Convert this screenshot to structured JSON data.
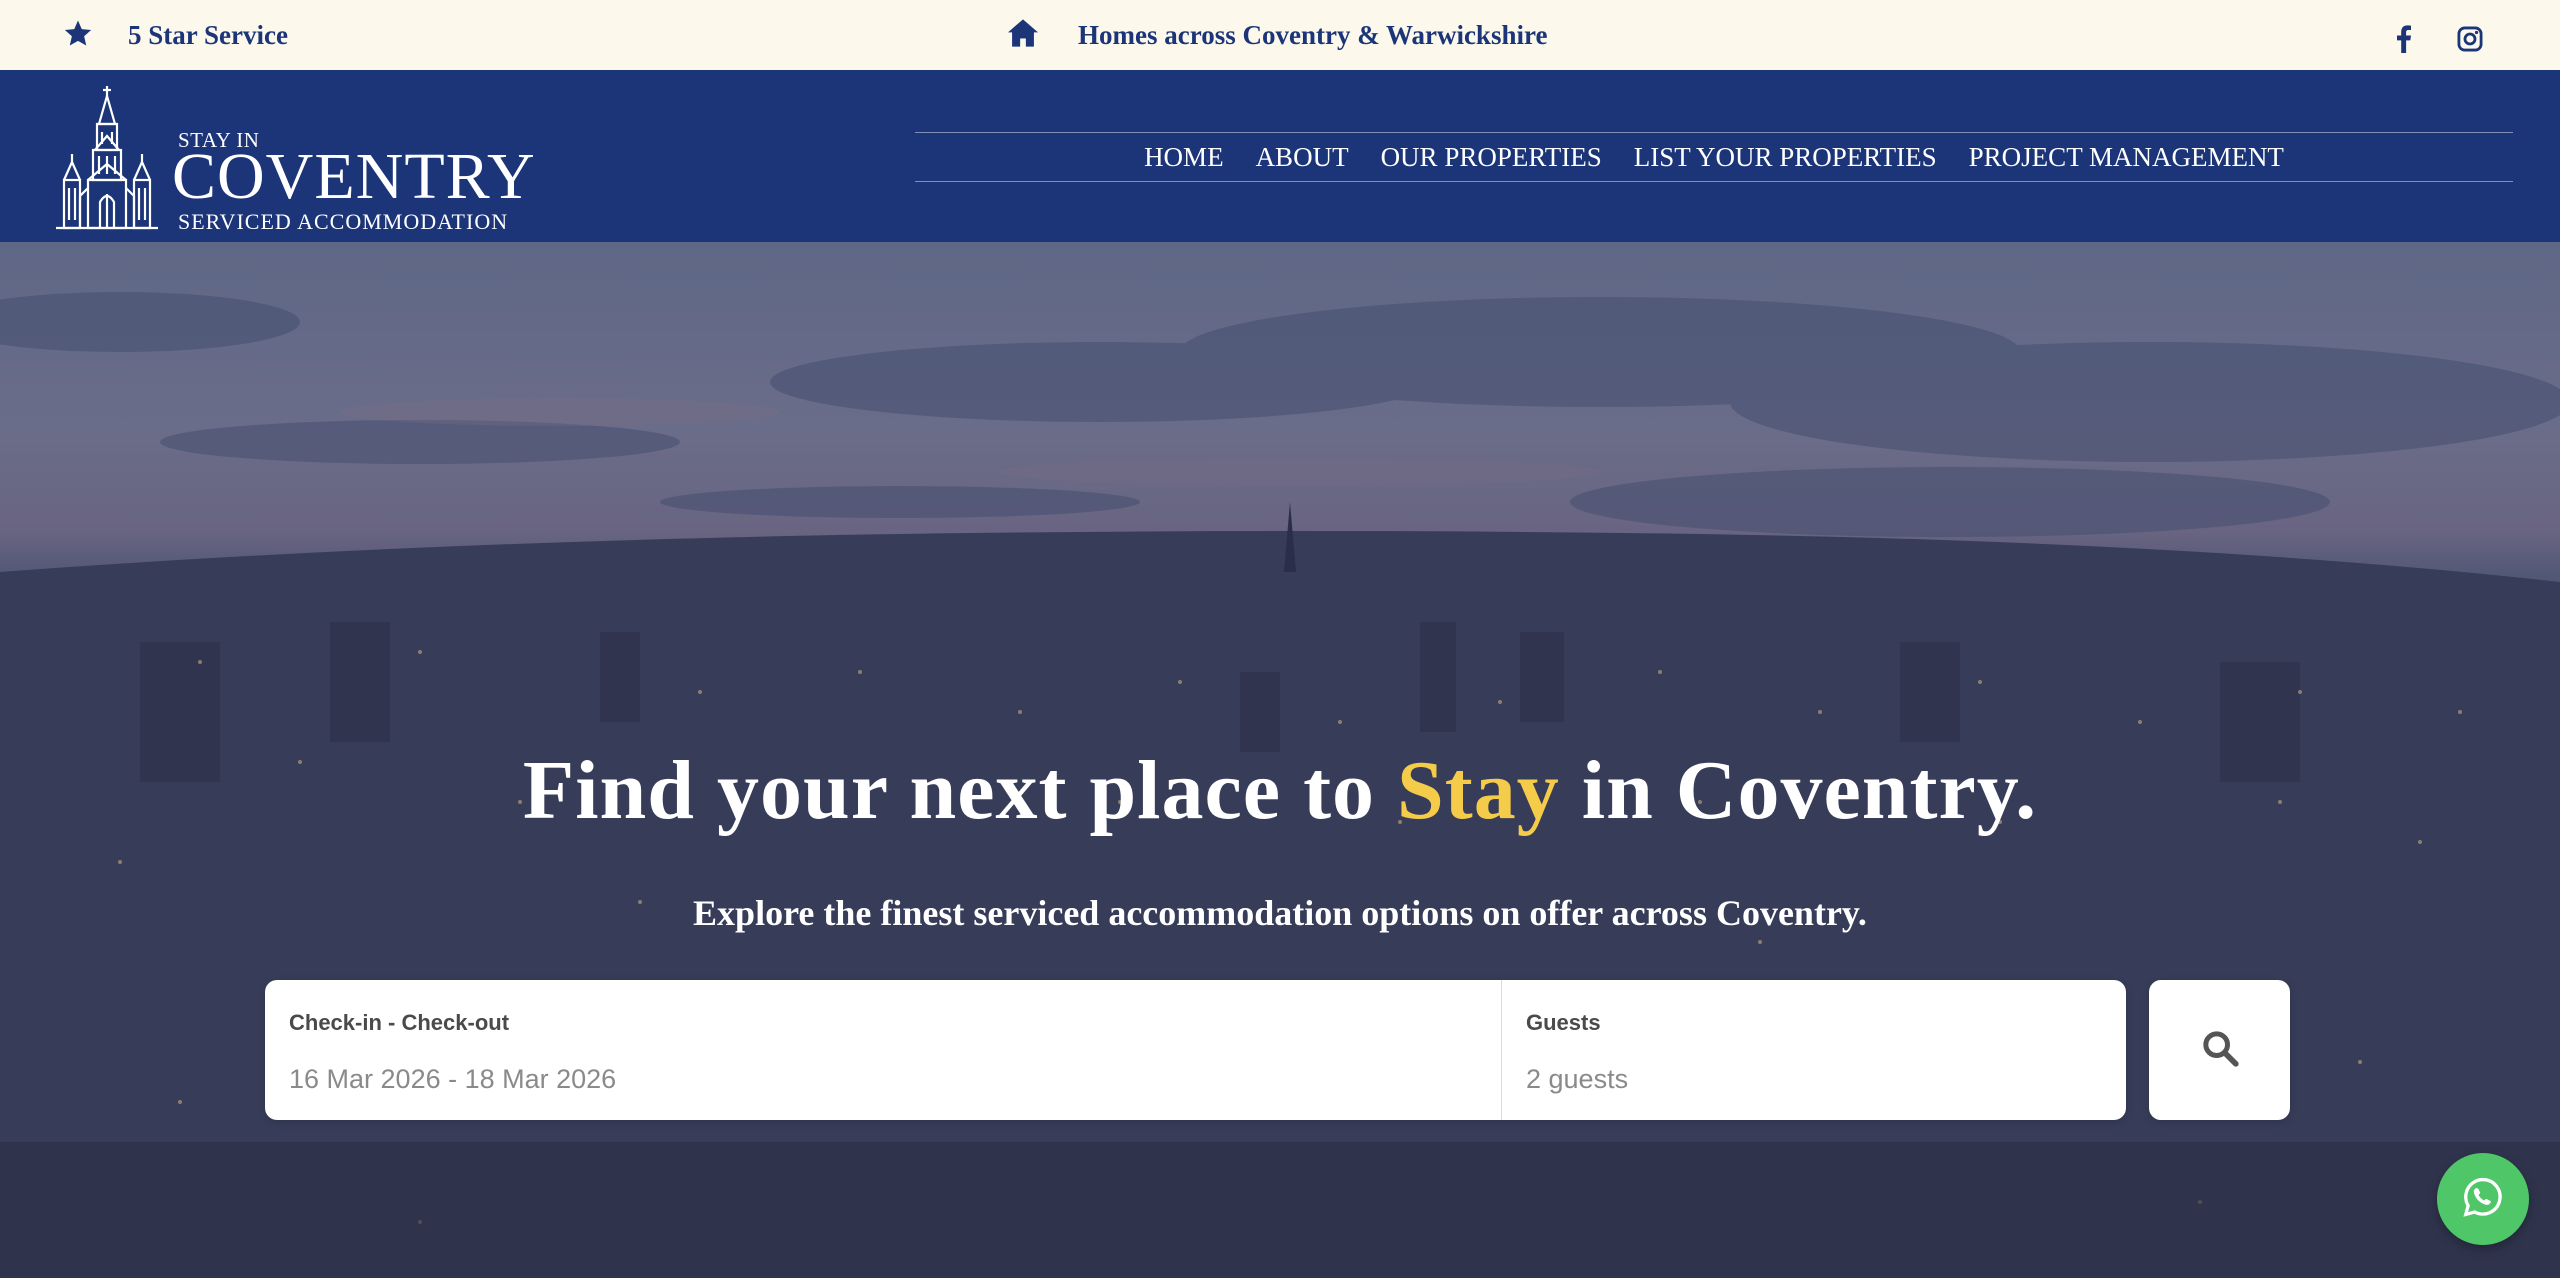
{
  "topbar": {
    "service_text": "5 Star Service",
    "homes_text": "Homes across Coventry & Warwickshire",
    "icons": {
      "left": "star-icon",
      "center": "home-icon",
      "social": [
        "facebook-icon",
        "instagram-icon"
      ]
    }
  },
  "logo": {
    "stay_in": "STAY IN",
    "name": "COVENTRY",
    "tagline": "SERVICED ACCOMMODATION"
  },
  "nav": {
    "items": [
      "HOME",
      "ABOUT",
      "OUR PROPERTIES",
      "LIST YOUR PROPERTIES",
      "PROJECT MANAGEMENT"
    ]
  },
  "hero": {
    "headline_before": "Find your next place to ",
    "headline_accent": "Stay",
    "headline_after": " in Coventry.",
    "subheadline": "Explore the finest serviced accommodation options on offer across Coventry."
  },
  "search": {
    "dates_label": "Check-in - Check-out",
    "dates_value": "16 Mar 2026 - 18 Mar 2026",
    "guests_label": "Guests",
    "guests_value": "2 guests",
    "button_icon": "search-icon"
  },
  "colors": {
    "brand_navy": "#1b3578",
    "topbar_bg": "#fcf9ec",
    "accent_yellow": "#f5cc4a",
    "whatsapp_green": "#4fc668"
  }
}
